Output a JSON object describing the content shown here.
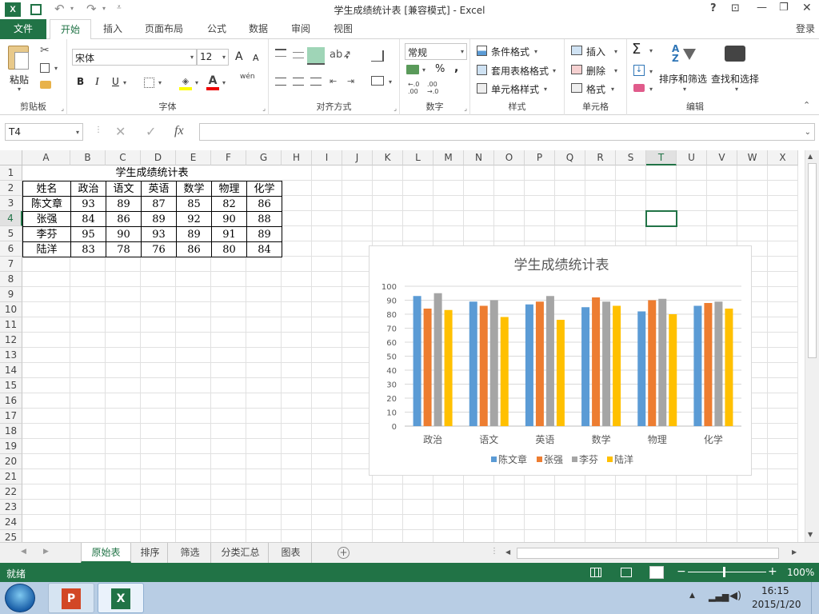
{
  "title": "学生成绩统计表  [兼容模式] - Excel",
  "window_controls": {
    "help": "?",
    "ribbon_options": "⊡",
    "minimize": "—",
    "restore": "❐",
    "close": "✕"
  },
  "quick_access": {
    "undo": "↶",
    "redo": "↷",
    "customize": "≡"
  },
  "login": "登录",
  "file_tab": "文件",
  "tabs": [
    "开始",
    "插入",
    "页面布局",
    "公式",
    "数据",
    "审阅",
    "视图"
  ],
  "ribbon": {
    "clipboard": {
      "paste": "粘贴",
      "group": "剪贴板"
    },
    "font": {
      "name": "宋体",
      "size": "12",
      "bold": "B",
      "italic": "I",
      "underline": "U",
      "grow": "A",
      "shrink": "A",
      "wen": "wén",
      "group": "字体"
    },
    "align": {
      "group": "对齐方式"
    },
    "number": {
      "format": "常规",
      "percent": "%",
      "comma": ",",
      "inc_dec": "←.0\n.00",
      "dec_dec": ".00\n→.0",
      "group": "数字"
    },
    "styles": {
      "cond": "条件格式",
      "table": "套用表格格式",
      "cell": "单元格样式",
      "group": "样式"
    },
    "cells": {
      "insert": "插入",
      "delete": "删除",
      "format": "格式",
      "group": "单元格"
    },
    "editing": {
      "sum": "Σ",
      "sort": "排序和筛选",
      "find": "查找和选择",
      "group": "编辑"
    }
  },
  "formula_bar": {
    "name_box": "T4",
    "cancel": "✕",
    "enter": "✓",
    "fx": "fx",
    "value": ""
  },
  "columns": [
    "A",
    "B",
    "C",
    "D",
    "E",
    "F",
    "G",
    "H",
    "I",
    "J",
    "K",
    "L",
    "M",
    "N",
    "O",
    "P",
    "Q",
    "R",
    "S",
    "T",
    "U",
    "V",
    "W",
    "X"
  ],
  "rows": [
    "1",
    "2",
    "3",
    "4",
    "5",
    "6",
    "7",
    "8",
    "9",
    "10",
    "11",
    "12",
    "13",
    "14",
    "15",
    "16",
    "17",
    "18",
    "19",
    "20",
    "21",
    "22",
    "23",
    "24",
    "25"
  ],
  "table": {
    "title": "学生成绩统计表",
    "headers": [
      "姓名",
      "政治",
      "语文",
      "英语",
      "数学",
      "物理",
      "化学"
    ],
    "rows": [
      [
        "陈文章",
        "93",
        "89",
        "87",
        "85",
        "82",
        "86"
      ],
      [
        "张强",
        "84",
        "86",
        "89",
        "92",
        "90",
        "88"
      ],
      [
        "李芬",
        "95",
        "90",
        "93",
        "89",
        "91",
        "89"
      ],
      [
        "陆洋",
        "83",
        "78",
        "76",
        "86",
        "80",
        "84"
      ]
    ]
  },
  "chart_data": {
    "type": "bar",
    "title": "学生成绩统计表",
    "categories": [
      "政治",
      "语文",
      "英语",
      "数学",
      "物理",
      "化学"
    ],
    "series": [
      {
        "name": "陈文章",
        "values": [
          93,
          89,
          87,
          85,
          82,
          86
        ],
        "color": "#5b9bd5"
      },
      {
        "name": "张强",
        "values": [
          84,
          86,
          89,
          92,
          90,
          88
        ],
        "color": "#ed7d31"
      },
      {
        "name": "李芬",
        "values": [
          95,
          90,
          93,
          89,
          91,
          89
        ],
        "color": "#a5a5a5"
      },
      {
        "name": "陆洋",
        "values": [
          83,
          78,
          76,
          86,
          80,
          84
        ],
        "color": "#ffc000"
      }
    ],
    "ylim": [
      0,
      100
    ],
    "yticks": [
      "0",
      "10",
      "20",
      "30",
      "40",
      "50",
      "60",
      "70",
      "80",
      "90",
      "100"
    ],
    "grid": true,
    "legend": "bottom"
  },
  "sheet_tabs": [
    "原始表",
    "排序",
    "筛选",
    "分类汇总",
    "图表"
  ],
  "active_sheet_tab": "原始表",
  "status": {
    "ready": "就绪",
    "zoom": "100%"
  },
  "taskbar": {
    "time": "16:15",
    "date": "2015/1/20"
  },
  "colors": {
    "excel_green": "#217346",
    "selection": "#217346",
    "accent_tab": "#217346"
  }
}
